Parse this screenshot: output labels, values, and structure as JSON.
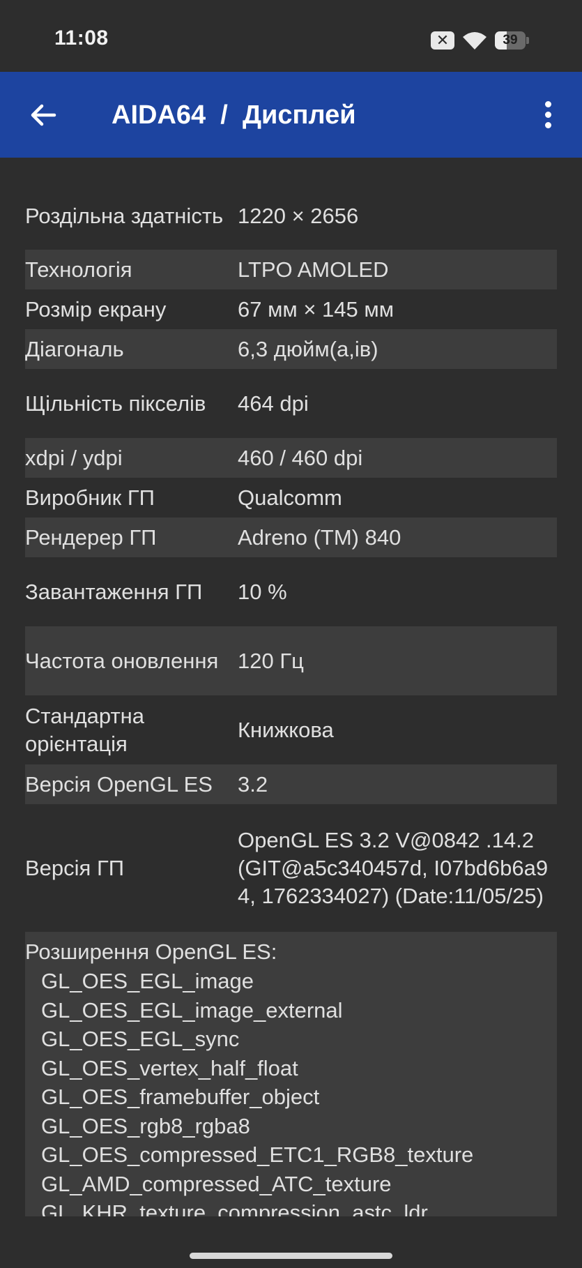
{
  "status_bar": {
    "time": "11:08",
    "battery_level": "39",
    "battery_fraction": 0.39
  },
  "app_bar": {
    "title": "AIDA64  /  Дисплей"
  },
  "rows": [
    {
      "label": "Роздільна здатність",
      "value": "1220 × 2656"
    },
    {
      "label": "Технологія",
      "value": "LTPO AMOLED"
    },
    {
      "label": "Розмір екрану",
      "value": "67 мм × 145 мм"
    },
    {
      "label": "Діагональ",
      "value": "6,3 дюйм(а,ів)"
    },
    {
      "label": "Щільність пікселів",
      "value": "464 dpi"
    },
    {
      "label": "xdpi / ydpi",
      "value": "460 / 460 dpi"
    },
    {
      "label": "Виробник ГП",
      "value": "Qualcomm"
    },
    {
      "label": "Рендерер ГП",
      "value": "Adreno (TM) 840"
    },
    {
      "label": "Завантаження ГП",
      "value": "10 %"
    },
    {
      "label": "Частота оновлення",
      "value": "120 Гц"
    },
    {
      "label": "Стандартна орієнтація",
      "value": "Книжкова"
    },
    {
      "label": "Версія OpenGL ES",
      "value": "3.2"
    },
    {
      "label": "Версія ГП",
      "value": "OpenGL ES 3.2 V@0842 .14.2 (GIT@a5c340457d, I07bd6b6a94, 1762334027) (Date:11/05/25)"
    }
  ],
  "extensions": {
    "title": "Розширення OpenGL ES:",
    "items": [
      "GL_OES_EGL_image",
      "GL_OES_EGL_image_external",
      "GL_OES_EGL_sync",
      "GL_OES_vertex_half_float",
      "GL_OES_framebuffer_object",
      "GL_OES_rgb8_rgba8",
      "GL_OES_compressed_ETC1_RGB8_texture",
      "GL_AMD_compressed_ATC_texture",
      "GL_KHR_texture_compression_astc_ldr"
    ]
  },
  "colors": {
    "app_bar": "#1d44a0",
    "background": "#2d2d2d",
    "row_alt": "#3d3d3d"
  }
}
